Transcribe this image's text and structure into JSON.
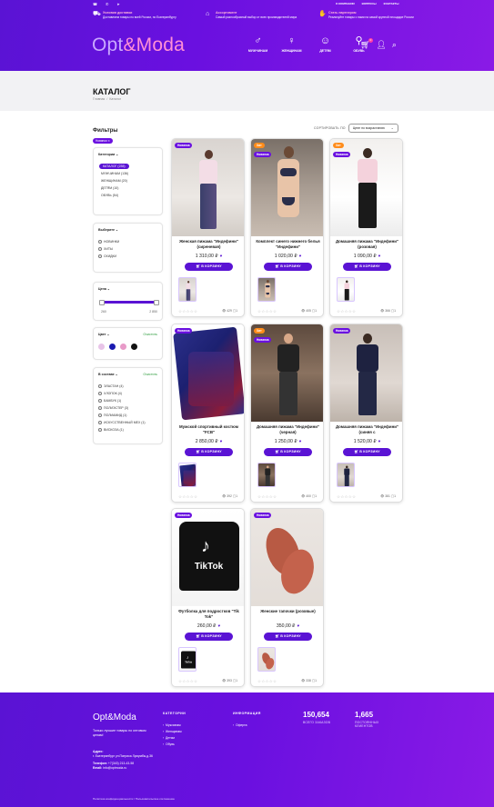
{
  "header": {
    "logo_part1": "Opt",
    "logo_part2": "&Moda",
    "top_links": [
      "О КОМПАНИИ",
      "ВОПРОСЫ",
      "КОНТАКТЫ"
    ],
    "features": [
      {
        "icon": "truck-icon",
        "title": "Условия доставки",
        "text": "Доставляем товары по всей России, по Екатеринбургу"
      },
      {
        "icon": "tag-icon",
        "title": "Ассортимент",
        "text": "Самый разнообразный выбор от всех производителей мира"
      },
      {
        "icon": "handshake-icon",
        "title": "Стать партнером",
        "text": "Реализуйте товары с нами на самой крупной площадке России"
      }
    ],
    "nav": [
      {
        "icon": "man-icon",
        "label": "МУЖЧИНАМ"
      },
      {
        "icon": "woman-icon",
        "label": "ЖЕНЩИНАМ"
      },
      {
        "icon": "child-icon",
        "label": "ДЕТЯМ"
      },
      {
        "icon": "boot-icon",
        "label": "ОБУВЬ"
      }
    ],
    "cart_count": "0"
  },
  "page": {
    "title": "КАТАЛОГ",
    "breadcrumb": [
      "Главная",
      "/",
      "Каталог"
    ],
    "sort_label": "СОРТИРОВАТЬ ПО",
    "sort_value": "Цене по возрастанию"
  },
  "filters": {
    "title": "Фильтры",
    "active_badge": "Новинки ✕",
    "categories_title": "Категории",
    "categories": [
      "КАТАЛОГ (235)",
      "МУЖЧИНАМ (136)",
      "ЖЕНЩИНАМ (20)",
      "ДЕТЯМ (10)",
      "ОБУВЬ (54)"
    ],
    "select_title": "Выберите",
    "select_options": [
      "НОВИНКИ",
      "ХИТЫ",
      "СКИДКИ"
    ],
    "price_title": "Цена",
    "price_min": "260",
    "price_max": "2 850",
    "color_title": "Цвет",
    "color_clear": "Очистить",
    "colors": [
      "#e8c4e8",
      "#1a1ab0",
      "#e89ac8",
      "#111111"
    ],
    "composition_title": "В составе",
    "composition_clear": "Очистить",
    "composition": [
      "ЭЛАСТАН (4)",
      "ХЛОПОК (4)",
      "БАМБУК (1)",
      "ПОЛИЭСТЕР (3)",
      "ПОЛИАМИД (1)",
      "ИСКУССТВЕННЫЙ МЕХ (1)",
      "ВИСКОЗА (1)"
    ]
  },
  "products": [
    {
      "name": "Женская пижама \"Индефини\" (сиреневая)",
      "price": "1 310,00 ₽",
      "views": "429",
      "badges": [
        "Новинка"
      ],
      "btn": "В КОРЗИНУ"
    },
    {
      "name": "Комплект синего нижнего белья \"Индефини\"",
      "price": "1 020,00 ₽",
      "views": "405",
      "badges": [
        "Хит",
        "Новинка"
      ],
      "btn": "В КОРЗИНУ"
    },
    {
      "name": "Домашняя пижама \"Индефини\" (розовая)",
      "price": "1 090,00 ₽",
      "views": "366",
      "badges": [
        "Хит",
        "Новинка"
      ],
      "btn": "В КОРЗИНУ"
    },
    {
      "name": "Мужской спортивный костюм \"FCB\"",
      "price": "2 850,00 ₽",
      "views": "392",
      "badges": [
        "Новинка"
      ],
      "btn": "В КОРЗИНУ"
    },
    {
      "name": "Домашняя пижама \"Индефини\" (черная)",
      "price": "1 250,00 ₽",
      "views": "400",
      "badges": [
        "Хит",
        "Новинка"
      ],
      "btn": "В КОРЗИНУ"
    },
    {
      "name": "Домашняя пижама \"Индефини\" (синяя с",
      "price": "1 520,00 ₽",
      "views": "381",
      "badges": [
        "Новинка"
      ],
      "btn": "В КОРЗИНУ"
    },
    {
      "name": "Футболка для подростков \"Tik Tok\"",
      "price": "260,00 ₽",
      "views": "393",
      "badges": [
        "Новинка"
      ],
      "btn": "В КОРЗИНУ"
    },
    {
      "name": "Женские тапочки (розовые)",
      "price": "350,00 ₽",
      "views": "338",
      "badges": [
        "Новинка"
      ],
      "btn": "В КОРЗИНУ"
    }
  ],
  "footer": {
    "logo": "Opt&Moda",
    "tagline": "Только лучшие товары по оптовым ценам!",
    "address_label": "Адрес:",
    "address": "г. Екатеринбург ул.Патриса Лумумбы,д.36",
    "phone_label": "Телефон:",
    "phone": "+7(343) 213-43-58",
    "email_label": "Email:",
    "email": "info@optmoda.ru",
    "categories_title": "КАТЕГОРИИ",
    "categories": [
      "Мужчинам",
      "Женщинам",
      "Детям",
      "Обувь"
    ],
    "info_title": "ИНФОРМАЦИЯ",
    "info": [
      "Оферта"
    ],
    "stat1_value": "150,654",
    "stat1_label": "ВСЕГО ЗАКАЗОВ",
    "stat2_value": "1,665",
    "stat2_label": "ПОСТОЯННЫХ КЛИЕНТОВ",
    "policy": "Политика конфиденциальности / Пользовательское соглашение"
  }
}
